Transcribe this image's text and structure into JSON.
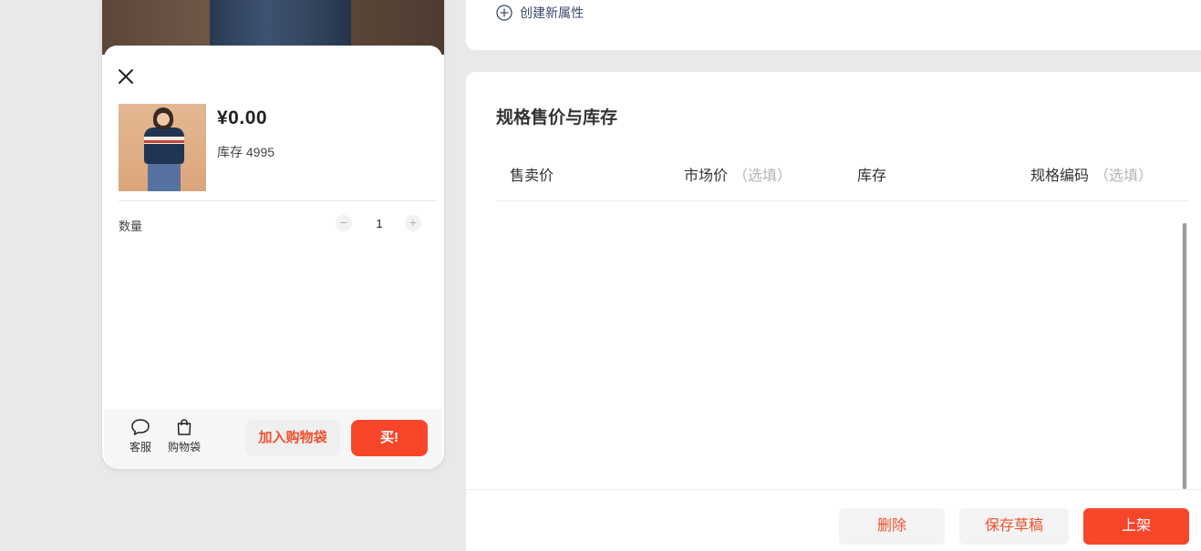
{
  "preview": {
    "price": "¥0.00",
    "stock": "库存 4995",
    "quantity_label": "数量",
    "quantity_value": "1",
    "minus": "−",
    "plus": "+",
    "actions": {
      "service_label": "客服",
      "bag_label": "购物袋"
    },
    "add_to_cart_label": "加入购物袋",
    "buy_label": "买!"
  },
  "attributes": {
    "create_label": "创建新属性"
  },
  "spec_section": {
    "title": "规格售价与库存",
    "columns": [
      {
        "label": "售卖价",
        "optional": ""
      },
      {
        "label": "市场价",
        "optional": "（选填）"
      },
      {
        "label": "库存",
        "optional": ""
      },
      {
        "label": "规格编码",
        "optional": "（选填）"
      }
    ]
  },
  "footer": {
    "delete_label": "删除",
    "draft_label": "保存草稿",
    "publish_label": "上架"
  },
  "colors": {
    "accent": "#f8462b",
    "accent_text": "#f0502f",
    "link": "#3c4a6e"
  },
  "icons": [
    "close-icon",
    "chat-bubble-icon",
    "shopping-bag-icon",
    "plus-circle-icon"
  ]
}
